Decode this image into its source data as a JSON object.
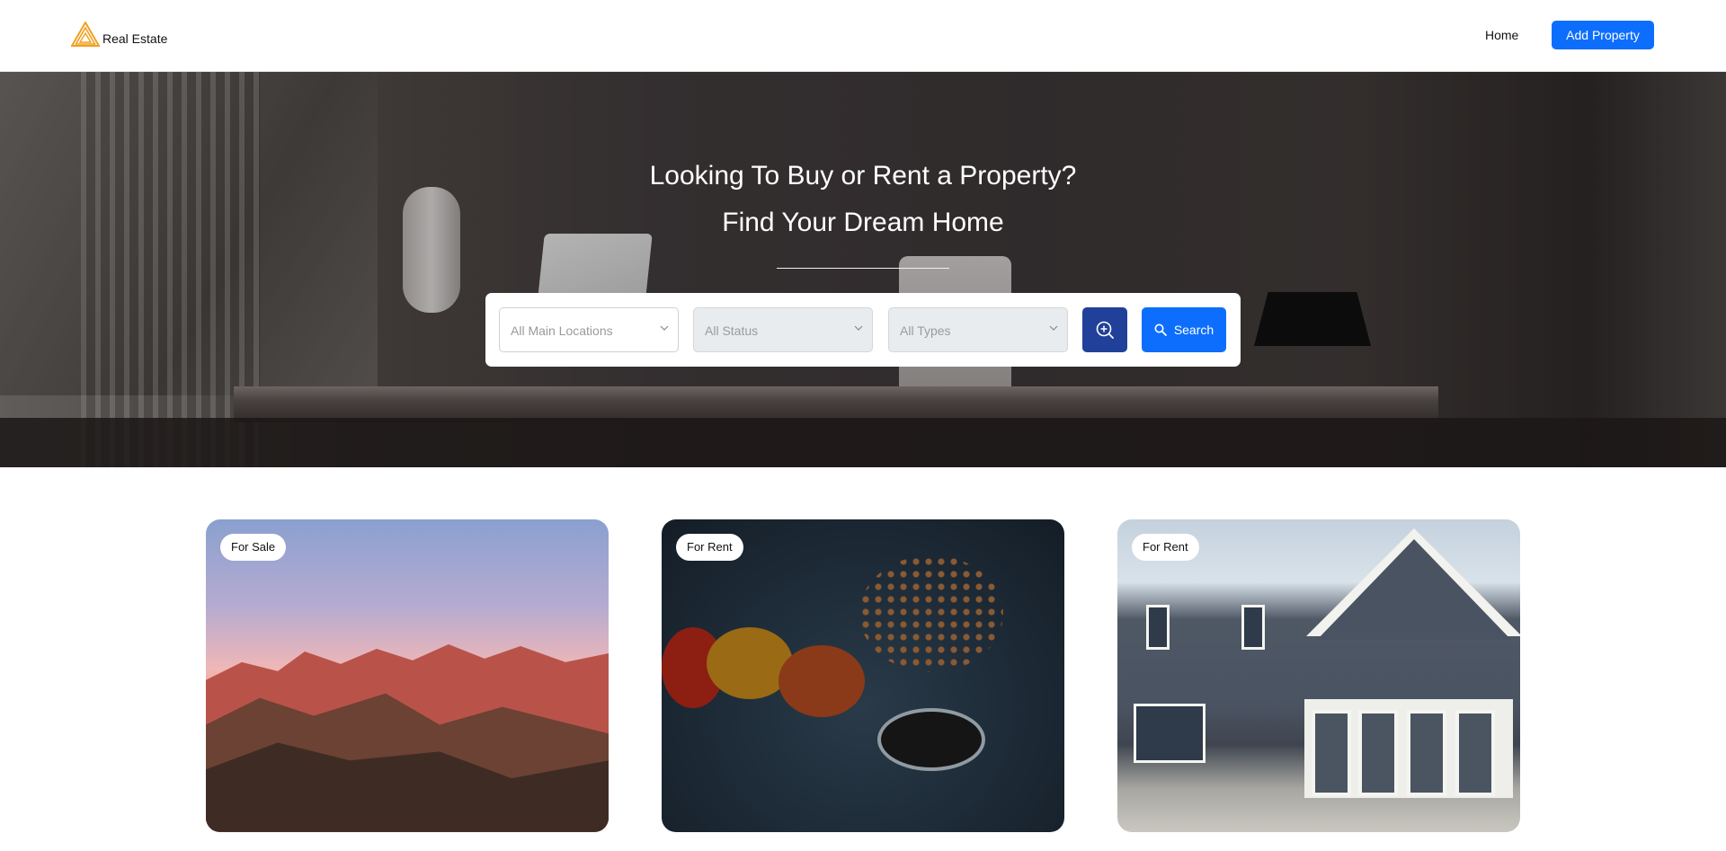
{
  "header": {
    "brand": "Real Estate",
    "nav_home": "Home",
    "add_property": "Add Property",
    "brand_color": "#f0a020",
    "accent": "#0d6efd"
  },
  "hero": {
    "title_line1": "Looking To Buy or Rent a Property?",
    "title_line2": "Find Your Dream Home"
  },
  "search": {
    "locations_placeholder": "All Main Locations",
    "status_placeholder": "All Status",
    "types_placeholder": "All Types",
    "advanced_icon": "zoom-in-icon",
    "search_label": "Search",
    "search_icon": "search-icon",
    "advanced_color": "#20409a"
  },
  "cards": [
    {
      "badge": "For Sale"
    },
    {
      "badge": "For Rent"
    },
    {
      "badge": "For Rent"
    }
  ]
}
